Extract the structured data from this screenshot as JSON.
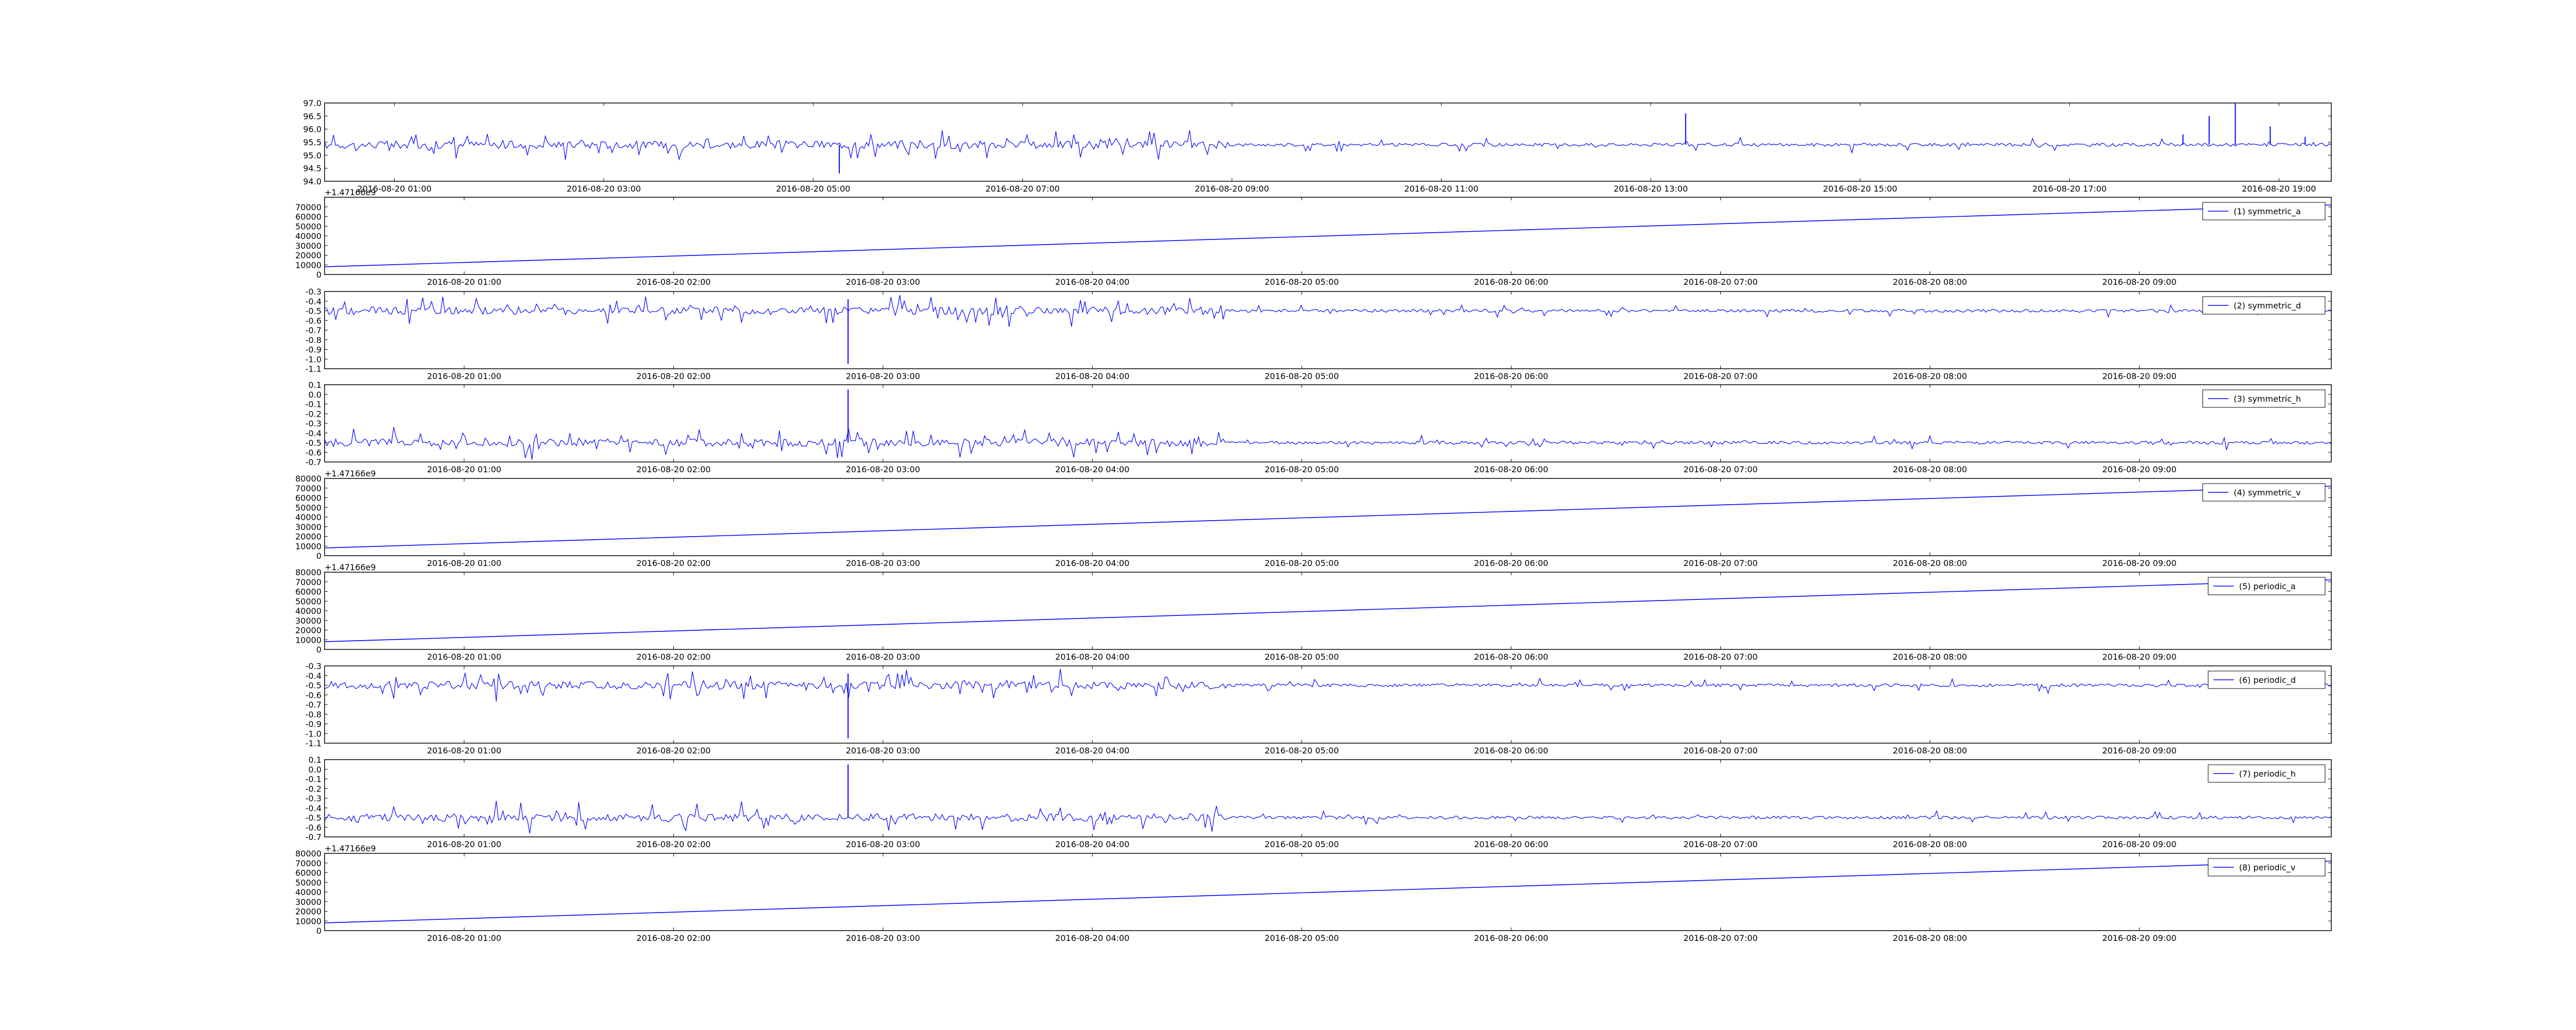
{
  "chart_data": [
    {
      "type": "line",
      "title": "",
      "ylim": [
        94.0,
        97.0
      ],
      "y_ticks": [
        "94.0",
        "94.5",
        "95.0",
        "95.5",
        "96.0",
        "96.5",
        "97.0"
      ],
      "x_ticks": [
        "2016-08-20 01:00",
        "2016-08-20 03:00",
        "2016-08-20 05:00",
        "2016-08-20 07:00",
        "2016-08-20 09:00",
        "2016-08-20 11:00",
        "2016-08-20 13:00",
        "2016-08-20 15:00",
        "2016-08-20 17:00",
        "2016-08-20 19:00"
      ],
      "x_range": [
        "2016-08-20 00:20",
        "2016-08-20 19:30"
      ],
      "series": [
        {
          "name": "",
          "baseline": 95.4,
          "spikes": [
            [
              "2016-08-20 05:15",
              94.3
            ],
            [
              "2016-08-20 13:20",
              96.6
            ],
            [
              "2016-08-20 18:05",
              95.8
            ],
            [
              "2016-08-20 18:20",
              96.5
            ],
            [
              "2016-08-20 18:35",
              97.0
            ],
            [
              "2016-08-20 18:55",
              96.1
            ],
            [
              "2016-08-20 19:15",
              95.7
            ]
          ]
        }
      ],
      "color": "#0000ff"
    },
    {
      "type": "line",
      "offset_label": "+1.47166e9",
      "ylim": [
        0,
        80000
      ],
      "y_ticks": [
        "0",
        "10000",
        "20000",
        "30000",
        "40000",
        "50000",
        "60000",
        "70000"
      ],
      "x_ticks": [
        "2016-08-20 01:00",
        "2016-08-20 02:00",
        "2016-08-20 03:00",
        "2016-08-20 04:00",
        "2016-08-20 05:00",
        "2016-08-20 06:00",
        "2016-08-20 07:00",
        "2016-08-20 08:00",
        "2016-08-20 09:00"
      ],
      "x_range": [
        "2016-08-20 00:20",
        "2016-08-20 09:55"
      ],
      "series": [
        {
          "name": "(1) symmetric_a",
          "start": 8000,
          "end": 72000
        }
      ],
      "legend": "top-right",
      "color": "#0000ff"
    },
    {
      "type": "line",
      "ylim": [
        -1.1,
        -0.3
      ],
      "y_ticks": [
        "-1.1",
        "-1.0",
        "-0.9",
        "-0.8",
        "-0.7",
        "-0.6",
        "-0.5",
        "-0.4",
        "-0.3"
      ],
      "x_ticks": [
        "2016-08-20 01:00",
        "2016-08-20 02:00",
        "2016-08-20 03:00",
        "2016-08-20 04:00",
        "2016-08-20 05:00",
        "2016-08-20 06:00",
        "2016-08-20 07:00",
        "2016-08-20 08:00",
        "2016-08-20 09:00"
      ],
      "x_range": [
        "2016-08-20 00:20",
        "2016-08-20 09:55"
      ],
      "series": [
        {
          "name": "(2) symmetric_d",
          "baseline": -0.5,
          "spikes": [
            [
              "2016-08-20 02:50",
              -1.05
            ],
            [
              "2016-08-20 02:50",
              -0.38
            ]
          ]
        }
      ],
      "legend": "top-right",
      "color": "#0000ff"
    },
    {
      "type": "line",
      "ylim": [
        -0.7,
        0.1
      ],
      "y_ticks": [
        "-0.7",
        "-0.6",
        "-0.5",
        "-0.4",
        "-0.3",
        "-0.2",
        "-0.1",
        "0.0",
        "0.1"
      ],
      "x_ticks": [
        "2016-08-20 01:00",
        "2016-08-20 02:00",
        "2016-08-20 03:00",
        "2016-08-20 04:00",
        "2016-08-20 05:00",
        "2016-08-20 06:00",
        "2016-08-20 07:00",
        "2016-08-20 08:00",
        "2016-08-20 09:00"
      ],
      "x_range": [
        "2016-08-20 00:20",
        "2016-08-20 09:55"
      ],
      "series": [
        {
          "name": "(3) symmetric_h",
          "baseline": -0.5,
          "spikes": [
            [
              "2016-08-20 02:50",
              0.05
            ]
          ]
        }
      ],
      "legend": "top-right",
      "color": "#0000ff"
    },
    {
      "type": "line",
      "offset_label": "+1.47166e9",
      "ylim": [
        0,
        80000
      ],
      "y_ticks": [
        "0",
        "10000",
        "20000",
        "30000",
        "40000",
        "50000",
        "60000",
        "70000",
        "80000"
      ],
      "x_ticks": [
        "2016-08-20 01:00",
        "2016-08-20 02:00",
        "2016-08-20 03:00",
        "2016-08-20 04:00",
        "2016-08-20 05:00",
        "2016-08-20 06:00",
        "2016-08-20 07:00",
        "2016-08-20 08:00",
        "2016-08-20 09:00"
      ],
      "x_range": [
        "2016-08-20 00:20",
        "2016-08-20 09:55"
      ],
      "series": [
        {
          "name": "(4) symmetric_v",
          "start": 8000,
          "end": 72000
        }
      ],
      "legend": "top-right",
      "color": "#0000ff"
    },
    {
      "type": "line",
      "offset_label": "+1.47166e9",
      "ylim": [
        0,
        80000
      ],
      "y_ticks": [
        "0",
        "10000",
        "20000",
        "30000",
        "40000",
        "50000",
        "60000",
        "70000",
        "80000"
      ],
      "x_ticks": [
        "2016-08-20 01:00",
        "2016-08-20 02:00",
        "2016-08-20 03:00",
        "2016-08-20 04:00",
        "2016-08-20 05:00",
        "2016-08-20 06:00",
        "2016-08-20 07:00",
        "2016-08-20 08:00",
        "2016-08-20 09:00"
      ],
      "x_range": [
        "2016-08-20 00:20",
        "2016-08-20 09:55"
      ],
      "series": [
        {
          "name": "(5) periodic_a",
          "start": 8000,
          "end": 72000
        }
      ],
      "legend": "top-right",
      "color": "#0000ff"
    },
    {
      "type": "line",
      "ylim": [
        -1.1,
        -0.3
      ],
      "y_ticks": [
        "-1.1",
        "-1.0",
        "-0.9",
        "-0.8",
        "-0.7",
        "-0.6",
        "-0.5",
        "-0.4",
        "-0.3"
      ],
      "x_ticks": [
        "2016-08-20 01:00",
        "2016-08-20 02:00",
        "2016-08-20 03:00",
        "2016-08-20 04:00",
        "2016-08-20 05:00",
        "2016-08-20 06:00",
        "2016-08-20 07:00",
        "2016-08-20 08:00",
        "2016-08-20 09:00"
      ],
      "x_range": [
        "2016-08-20 00:20",
        "2016-08-20 09:55"
      ],
      "series": [
        {
          "name": "(6) periodic_d",
          "baseline": -0.5,
          "spikes": [
            [
              "2016-08-20 02:50",
              -1.05
            ],
            [
              "2016-08-20 02:50",
              -0.38
            ]
          ]
        }
      ],
      "legend": "top-right",
      "color": "#0000ff"
    },
    {
      "type": "line",
      "ylim": [
        -0.7,
        0.1
      ],
      "y_ticks": [
        "-0.7",
        "-0.6",
        "-0.5",
        "-0.4",
        "-0.3",
        "-0.2",
        "-0.1",
        "0.0",
        "0.1"
      ],
      "x_ticks": [
        "2016-08-20 01:00",
        "2016-08-20 02:00",
        "2016-08-20 03:00",
        "2016-08-20 04:00",
        "2016-08-20 05:00",
        "2016-08-20 06:00",
        "2016-08-20 07:00",
        "2016-08-20 08:00",
        "2016-08-20 09:00"
      ],
      "x_range": [
        "2016-08-20 00:20",
        "2016-08-20 09:55"
      ],
      "series": [
        {
          "name": "(7) periodic_h",
          "baseline": -0.5,
          "spikes": [
            [
              "2016-08-20 02:50",
              0.05
            ]
          ]
        }
      ],
      "legend": "top-right",
      "color": "#0000ff"
    },
    {
      "type": "line",
      "offset_label": "+1.47166e9",
      "ylim": [
        0,
        80000
      ],
      "y_ticks": [
        "0",
        "10000",
        "20000",
        "30000",
        "40000",
        "50000",
        "60000",
        "70000",
        "80000"
      ],
      "x_ticks": [
        "2016-08-20 01:00",
        "2016-08-20 02:00",
        "2016-08-20 03:00",
        "2016-08-20 04:00",
        "2016-08-20 05:00",
        "2016-08-20 06:00",
        "2016-08-20 07:00",
        "2016-08-20 08:00",
        "2016-08-20 09:00"
      ],
      "x_range": [
        "2016-08-20 00:20",
        "2016-08-20 09:55"
      ],
      "series": [
        {
          "name": "(8) periodic_v",
          "start": 8000,
          "end": 72000
        }
      ],
      "legend": "top-right",
      "color": "#0000ff"
    }
  ]
}
